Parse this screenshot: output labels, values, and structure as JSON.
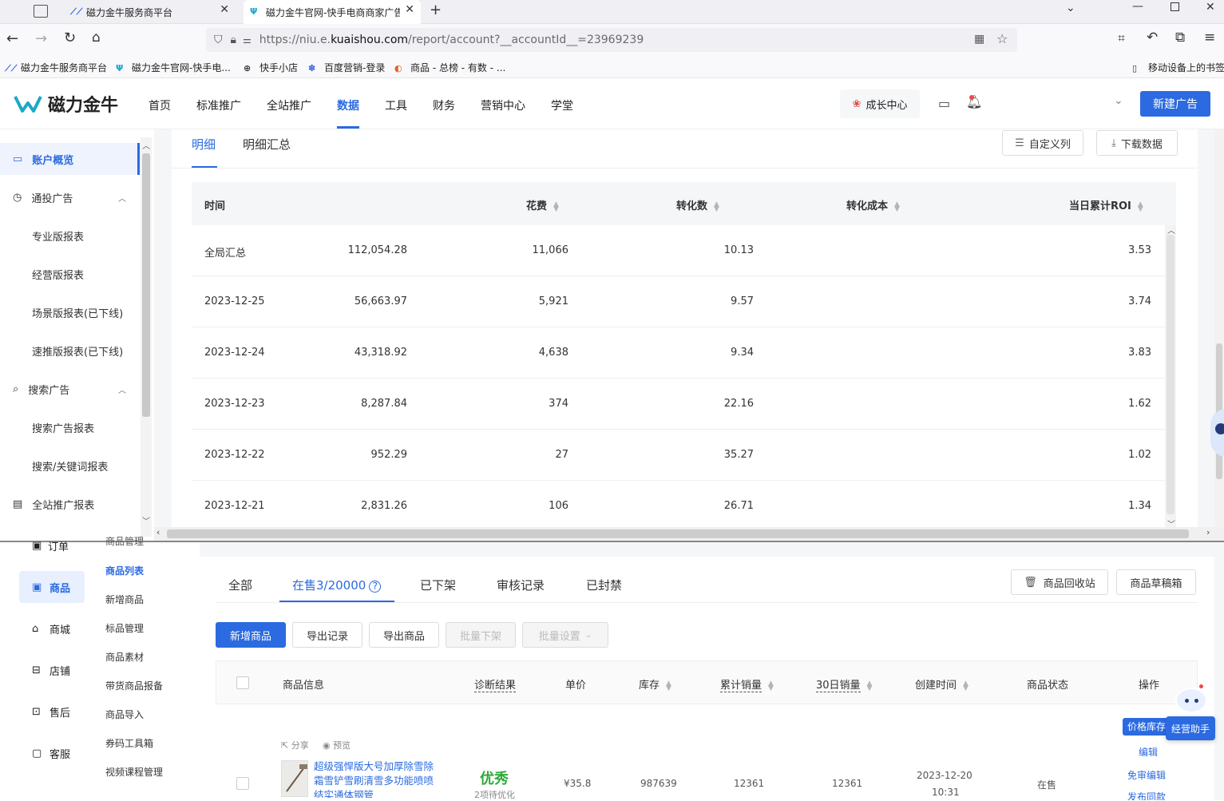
{
  "browser": {
    "tabs": [
      {
        "label": "磁力金牛服务商平台"
      },
      {
        "label": "磁力金牛官网-快手电商商家广告"
      }
    ],
    "url_prefix": "https://niu.e.",
    "url_domain": "kuaishou.com",
    "url_path": "/report/account?__accountId__=23969239",
    "bookmarks": [
      {
        "label": "磁力金牛服务商平台"
      },
      {
        "label": "磁力金牛官网-快手电..."
      },
      {
        "label": "快手小店"
      },
      {
        "label": "百度营销-登录"
      },
      {
        "label": "商品 - 总榜 - 有数 - ..."
      }
    ],
    "mobile_bookmarks": "移动设备上的书签"
  },
  "app": {
    "logo_text": "磁力金牛",
    "nav": [
      "首页",
      "标准推广",
      "全站推广",
      "数据",
      "工具",
      "财务",
      "营销中心",
      "学堂"
    ],
    "active_nav": "数据",
    "growth_center": "成长中心",
    "new_ad_button": "新建广告"
  },
  "sidebar": {
    "items": [
      {
        "label": "账户概览"
      },
      {
        "label": "通投广告"
      },
      {
        "label": "专业版报表"
      },
      {
        "label": "经营版报表"
      },
      {
        "label": "场景版报表(已下线)"
      },
      {
        "label": "速推版报表(已下线)"
      },
      {
        "label": "搜索广告"
      },
      {
        "label": "搜索广告报表"
      },
      {
        "label": "搜索/关键词报表"
      },
      {
        "label": "全站推广报表"
      }
    ]
  },
  "report": {
    "tabs": [
      "明细",
      "明细汇总"
    ],
    "custom_columns": "自定义列",
    "download": "下载数据",
    "columns": [
      "时间",
      "花费",
      "转化数",
      "转化成本",
      "当日累计ROI"
    ],
    "rows": [
      {
        "time": "全局汇总",
        "spend": "112,054.28",
        "conv": "11,066",
        "cost": "10.13",
        "roi": "3.53"
      },
      {
        "time": "2023-12-25",
        "spend": "56,663.97",
        "conv": "5,921",
        "cost": "9.57",
        "roi": "3.74"
      },
      {
        "time": "2023-12-24",
        "spend": "43,318.92",
        "conv": "4,638",
        "cost": "9.34",
        "roi": "3.83"
      },
      {
        "time": "2023-12-23",
        "spend": "8,287.84",
        "conv": "374",
        "cost": "22.16",
        "roi": "1.62"
      },
      {
        "time": "2023-12-22",
        "spend": "952.29",
        "conv": "27",
        "cost": "35.27",
        "roi": "1.02"
      },
      {
        "time": "2023-12-21",
        "spend": "2,831.26",
        "conv": "106",
        "cost": "26.71",
        "roi": "1.34"
      }
    ]
  },
  "shop": {
    "left_nav": [
      "订单",
      "商品",
      "商城",
      "店铺",
      "售后",
      "客服"
    ],
    "partial_label": "商品管理",
    "sub_nav": [
      "商品列表",
      "新增商品",
      "标品管理",
      "商品素材",
      "带货商品报备",
      "商品导入",
      "券码工具箱",
      "视频课程管理"
    ],
    "tabs": [
      "全部",
      "在售3/20000",
      "已下架",
      "审核记录",
      "已封禁"
    ],
    "recycle_bin": "商品回收站",
    "drafts": "商品草稿箱",
    "buttons": {
      "add": "新增商品",
      "export_log": "导出记录",
      "export": "导出商品",
      "batch_off": "批量下架",
      "batch_set": "批量设置"
    },
    "columns": [
      "商品信息",
      "诊断结果",
      "单价",
      "库存",
      "累计销量",
      "30日销量",
      "创建时间",
      "商品状态",
      "操作"
    ],
    "product": {
      "share": "分享",
      "preview": "预览",
      "title": "超级强悍版大号加厚除雪除霜雪铲雪刷清雪多功能喷喷结实通体钢管",
      "diagnosis": "优秀",
      "diagnosis_sub": "2项待优化",
      "price": "¥35.8",
      "stock": "987639",
      "total_sales": "12361",
      "sales_30d": "12361",
      "created_date": "2023-12-20",
      "created_time": "10:31",
      "status": "在售",
      "ops": [
        "编辑",
        "免审编辑",
        "发布同款"
      ],
      "price_stock": "价格库存",
      "assistant": "经营助手"
    }
  },
  "colors": {
    "accent": "#2b6ae0",
    "brand": "#1f6feb",
    "excellent": "#2eaa3a"
  }
}
